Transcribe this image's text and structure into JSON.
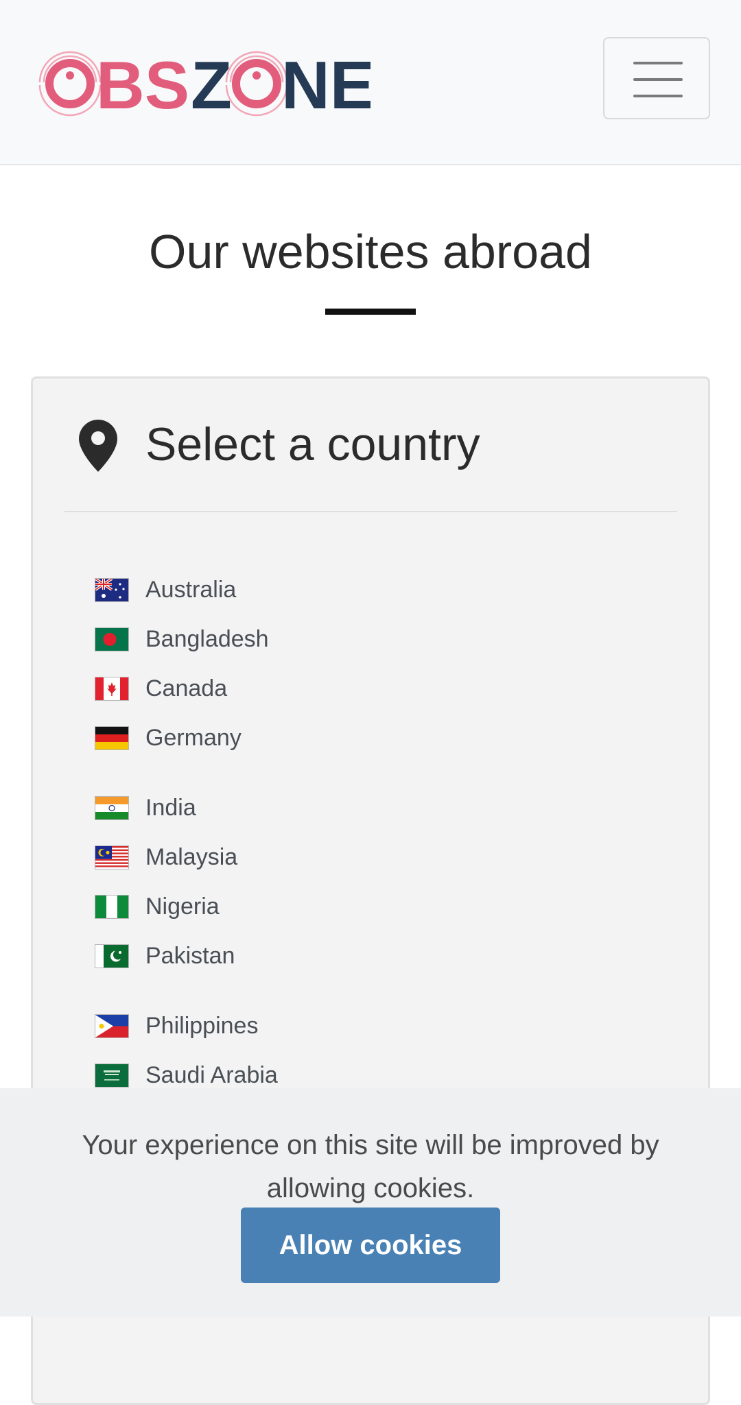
{
  "header": {
    "logo_text": "OBSZONE",
    "menu_toggle_icon": "hamburger-menu-icon",
    "brand_colors": {
      "pink": "#e25d7c",
      "navy": "#243a55"
    }
  },
  "main": {
    "title": "Our websites abroad"
  },
  "country_panel": {
    "title": "Select a country",
    "icon": "map-pin-icon",
    "countries": [
      {
        "name": "Australia",
        "flag": "australia-flag-icon"
      },
      {
        "name": "Bangladesh",
        "flag": "bangladesh-flag-icon"
      },
      {
        "name": "Canada",
        "flag": "canada-flag-icon"
      },
      {
        "name": "Germany",
        "flag": "germany-flag-icon"
      },
      {
        "name": "India",
        "flag": "india-flag-icon"
      },
      {
        "name": "Malaysia",
        "flag": "malaysia-flag-icon"
      },
      {
        "name": "Nigeria",
        "flag": "nigeria-flag-icon"
      },
      {
        "name": "Pakistan",
        "flag": "pakistan-flag-icon"
      },
      {
        "name": "Philippines",
        "flag": "philippines-flag-icon"
      },
      {
        "name": "Saudi Arabia",
        "flag": "saudi-arabia-flag-icon"
      }
    ]
  },
  "cookie_banner": {
    "message": "Your experience on this site will be improved by allowing cookies.",
    "button_label": "Allow cookies",
    "button_color": "#4981b4"
  }
}
